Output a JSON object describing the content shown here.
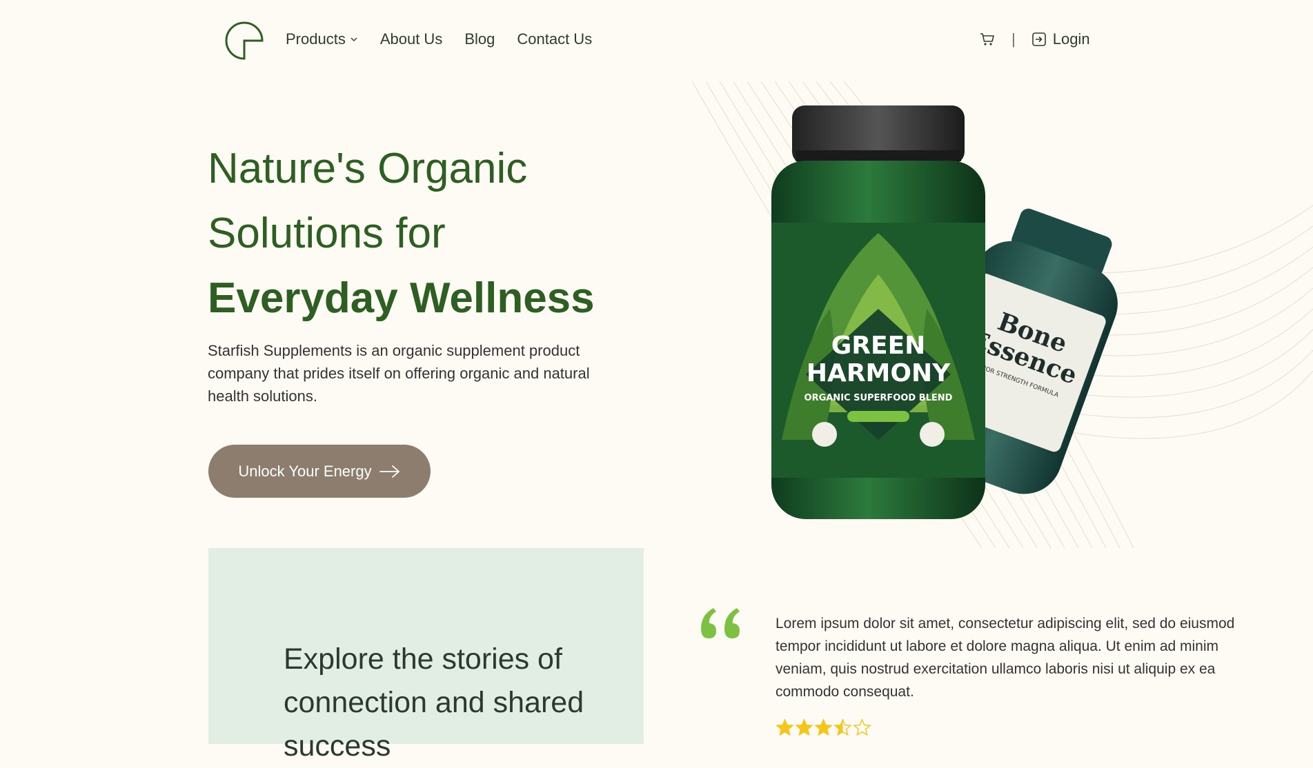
{
  "nav": {
    "items": [
      {
        "label": "Products",
        "has_dropdown": true
      },
      {
        "label": "About Us"
      },
      {
        "label": "Blog"
      },
      {
        "label": "Contact Us"
      }
    ],
    "separator": "|",
    "login_label": "Login"
  },
  "hero": {
    "title_line1": "Nature's Organic",
    "title_line2": "Solutions for",
    "title_line3": "Everyday Wellness",
    "description": "Starfish Supplements is an organic supplement product company that prides itself on offering organic and natural health solutions.",
    "cta_label": "Unlock Your Energy",
    "product1": {
      "name_line1": "GREEN",
      "name_line2": "HARMONY",
      "subtitle": "ORGANIC SUPERFOOD BLEND"
    },
    "product2": {
      "name_line1": "Bone",
      "name_line2": "Essence",
      "subtitle": "SENIOR STRENGTH FORMULA"
    }
  },
  "stories": {
    "heading": "Explore the stories of connection and shared success"
  },
  "testimonial": {
    "text": "Lorem ipsum dolor sit amet, consectetur adipiscing elit, sed do eiusmod tempor incididunt ut labore et dolore magna aliqua. Ut enim ad minim veniam, quis nostrud exercitation ullamco laboris nisi ut aliquip ex ea commodo consequat.",
    "rating": 3.5,
    "rating_max": 5
  },
  "colors": {
    "brand_green": "#2d5f22",
    "accent_green": "#7cc142",
    "cta_bg": "#8c7d6e",
    "stories_bg": "#e2eee3",
    "star_gold": "#f5c518",
    "page_bg": "#fdfbf4"
  },
  "icons": [
    "logo-mark",
    "chevron-down-icon",
    "cart-icon",
    "login-icon",
    "arrow-right-icon",
    "quote-icon",
    "star-icon"
  ]
}
